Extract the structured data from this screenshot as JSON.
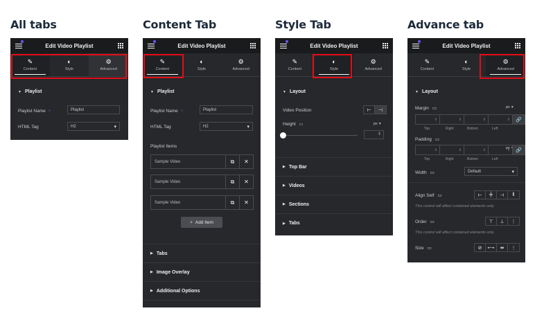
{
  "headings": [
    "All tabs",
    "Content Tab",
    "Style Tab",
    "Advance tab"
  ],
  "panel_title": "Edit Video Playlist",
  "tabs": [
    "Content",
    "Style",
    "Advanced"
  ],
  "icons": {
    "content": "pencil-icon",
    "style": "half-circle-icon",
    "advanced": "gear-icon"
  },
  "accent": "#e40d17",
  "p1": {
    "section": "Playlist",
    "name_label": "Playlist Name",
    "name_value": "Playlist",
    "tag_label": "HTML Tag",
    "tag_value": "H2"
  },
  "p2": {
    "section": "Playlist",
    "name_label": "Playlist Name",
    "name_value": "Playlist",
    "tag_label": "HTML Tag",
    "tag_value": "H2",
    "items_label": "Playlist Items",
    "items": [
      "Sample Video",
      "Sample Video",
      "Sample Video"
    ],
    "add": "Add Item",
    "sections": [
      "Tabs",
      "Image Overlay",
      "Additional Options"
    ]
  },
  "p3": {
    "section": "Layout",
    "video_pos": "Video Position",
    "height": "Height",
    "unit": "px",
    "sections": [
      "Top Bar",
      "Videos",
      "Sections",
      "Tabs"
    ]
  },
  "p4": {
    "section": "Layout",
    "margin": "Margin",
    "padding": "Padding",
    "unit": "px",
    "dims": [
      "Top",
      "Right",
      "Bottom",
      "Left"
    ],
    "width": "Width",
    "width_value": "Default",
    "align": "Align Self",
    "align_note": "This control will affect contained elements only.",
    "order": "Order",
    "order_note": "This control will affect contained elements only.",
    "size": "Size"
  }
}
